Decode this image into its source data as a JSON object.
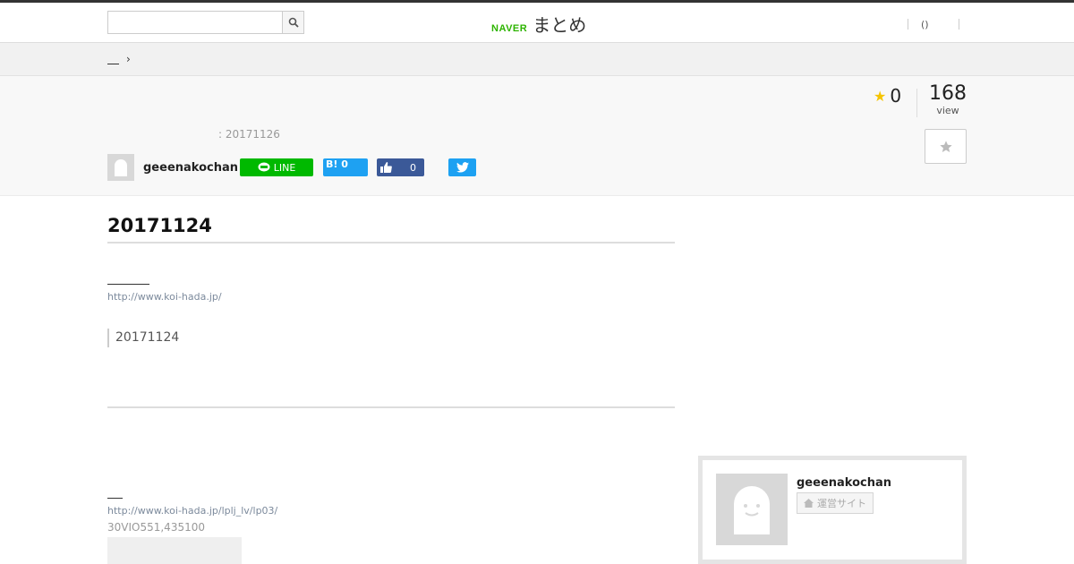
{
  "header": {
    "search_placeholder": "",
    "logo_naver": "NAVER",
    "logo_matome": "まとめ",
    "nav_right_label": "()"
  },
  "breadcrumb": {
    "arrow": "›"
  },
  "hero": {
    "favorite_count": "0",
    "view_count": "168",
    "view_label": "view",
    "updated": ": 20171126",
    "author": "geeenakochan",
    "share": {
      "line_label": "LINE",
      "hatena_label": "B!",
      "hatena_count": "0",
      "fb_count": "0"
    }
  },
  "article": {
    "title": "20171124",
    "link1": "http://www.koi-hada.jp/",
    "quote": "20171124",
    "link2": "http://www.koi-hada.jp/lplj_lv/lp03/",
    "note": "30VIO551,435100"
  },
  "sidebar": {
    "profile_name": "geeenakochan",
    "profile_site_label": "運営サイト"
  },
  "colors": {
    "line_green": "#00b900",
    "hatena_blue": "#1ea1f2",
    "facebook_blue": "#3b5998",
    "twitter_blue": "#1da1f2",
    "naver_green": "#2db400",
    "star_yellow": "#f5c400"
  }
}
